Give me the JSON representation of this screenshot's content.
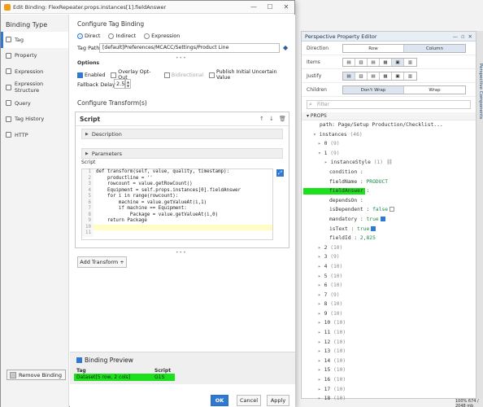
{
  "dialog": {
    "title": "Edit Binding: FlexRepeater.props.instances[1].fieldAnswer",
    "binding_type_heading": "Binding Type",
    "binding_types": [
      "Tag",
      "Property",
      "Expression",
      "Expression Structure",
      "Query",
      "Tag History",
      "HTTP"
    ],
    "selected_binding_type": "Tag",
    "remove_binding_label": "Remove Binding",
    "configure_title": "Configure Tag Binding",
    "modes": [
      "Direct",
      "Indirect",
      "Expression"
    ],
    "selected_mode": "Direct",
    "tag_path_label": "Tag Path",
    "tag_path_value": "[default]Preferences/MCACC/Settings/Product Line",
    "options_label": "Options",
    "options": [
      {
        "label": "Enabled",
        "checked": true,
        "disabled": false
      },
      {
        "label": "Overlay Opt-Out",
        "checked": false,
        "disabled": false
      },
      {
        "label": "Bidirectional",
        "checked": false,
        "disabled": true
      },
      {
        "label": "Publish Initial Uncertain Value",
        "checked": false,
        "disabled": false
      }
    ],
    "fallback_delay_label": "Fallback Delay",
    "fallback_delay_value": "2.5",
    "transform_title": "Configure Transform(s)",
    "script_panel_title": "Script",
    "description_label": "Description",
    "parameters_label": "Parameters",
    "script_label": "Script",
    "code_lines": [
      "def transform(self, value, quality, timestamp):",
      "    productline = ''",
      "    rowcount = value.getRowCount()",
      "    Equipment = self.props.instances[0].fieldAnswer",
      "    for i in range(rowcount):",
      "        machine = value.getValueAt(i,1)",
      "        if machine == Equipment:",
      "            Package = value.getValueAt(i,0)",
      "    return Package",
      "",
      ""
    ],
    "add_transform_label": "Add Transform +",
    "preview_title": "Binding Preview",
    "preview_columns": [
      "Tag",
      "Script"
    ],
    "preview_values": [
      "Dataset[5 row, 2 cols]",
      "G1S"
    ],
    "ok_label": "OK",
    "cancel_label": "Cancel",
    "apply_label": "Apply"
  },
  "property_editor": {
    "title": "Perspective Property Editor",
    "direction_label": "Direction",
    "direction_options": [
      "Row",
      "Column"
    ],
    "direction_selected": "Column",
    "items_label": "Items",
    "justify_label": "Justify",
    "children_label": "Children",
    "children_options": [
      "Don't Wrap",
      "Wrap"
    ],
    "children_selected": "Don't Wrap",
    "filter_placeholder": "Filter",
    "props_header": "PROPS",
    "path_key": "path",
    "path_value": "Page/Setup Production/Checklist...",
    "instances_key": "instances",
    "instances_count": "(46)",
    "item1_fields": [
      {
        "key": "instanceStyle",
        "value": "(1)"
      },
      {
        "key": "condition",
        "value": ""
      },
      {
        "key": "fieldName",
        "value": "PRODUCT"
      },
      {
        "key": "fieldAnswer",
        "value": ""
      },
      {
        "key": "dependsOn",
        "value": ""
      },
      {
        "key": "isDependent",
        "value": "false"
      },
      {
        "key": "mandatory",
        "value": "true"
      },
      {
        "key": "isText",
        "value": "true"
      },
      {
        "key": "fieldId",
        "value": "2,825"
      }
    ],
    "index_rows": [
      {
        "index": "0",
        "count": "(9)"
      },
      {
        "index": "1",
        "count": "(9)"
      },
      {
        "index": "2",
        "count": "(10)"
      },
      {
        "index": "3",
        "count": "(9)"
      },
      {
        "index": "4",
        "count": "(10)"
      },
      {
        "index": "5",
        "count": "(10)"
      },
      {
        "index": "6",
        "count": "(10)"
      },
      {
        "index": "7",
        "count": "(9)"
      },
      {
        "index": "8",
        "count": "(10)"
      },
      {
        "index": "9",
        "count": "(10)"
      },
      {
        "index": "10",
        "count": "(10)"
      },
      {
        "index": "11",
        "count": "(10)"
      },
      {
        "index": "12",
        "count": "(10)"
      },
      {
        "index": "13",
        "count": "(10)"
      },
      {
        "index": "14",
        "count": "(10)"
      },
      {
        "index": "15",
        "count": "(10)"
      },
      {
        "index": "16",
        "count": "(10)"
      },
      {
        "index": "17",
        "count": "(10)"
      },
      {
        "index": "18",
        "count": "(10)"
      }
    ],
    "side_tab_label": "Perspective Components",
    "status_text": "100%  674 / 2048 mb"
  },
  "colors": {
    "accent": "#2f7ad0",
    "highlight": "#1be01b"
  }
}
